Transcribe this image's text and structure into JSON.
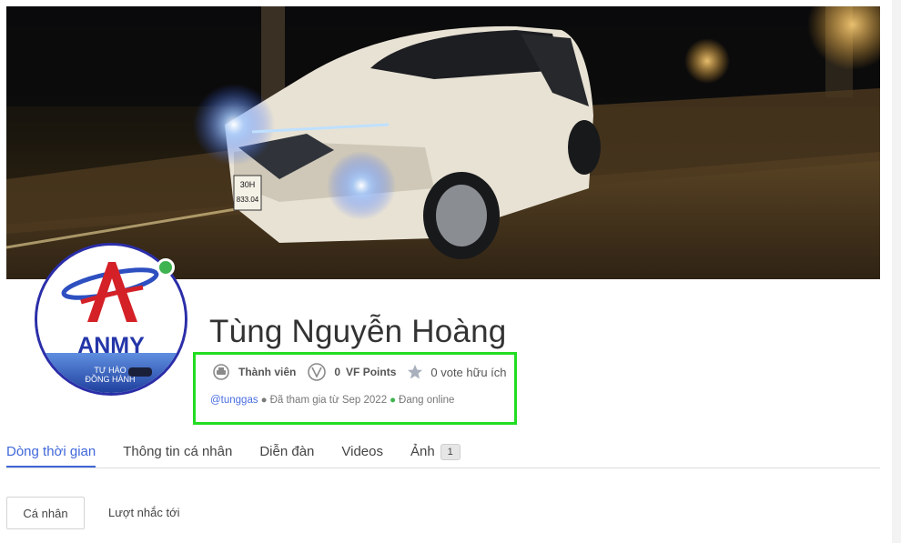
{
  "profile": {
    "name": "Tùng Nguyễn Hoàng",
    "avatar_text": "ANMY",
    "avatar_tagline_1": "TỰ HÀO",
    "avatar_tagline_2": "ĐỒNG HÀNH",
    "cover_plate_line1": "30H",
    "cover_plate_line2": "833.04",
    "online": true
  },
  "stats": {
    "rank_label": "Thành viên",
    "points_value": "0",
    "points_label": "VF Points",
    "votes_label": "0 vote hữu ích"
  },
  "meta": {
    "handle": "@tunggas",
    "joined": "Đã tham gia từ Sep 2022",
    "status": "Đang online"
  },
  "tabs": [
    {
      "label": "Dòng thời gian",
      "active": true
    },
    {
      "label": "Thông tin cá nhân",
      "active": false
    },
    {
      "label": "Diễn đàn",
      "active": false
    },
    {
      "label": "Videos",
      "active": false
    },
    {
      "label": "Ảnh",
      "active": false,
      "badge": "1"
    }
  ],
  "subtabs": [
    {
      "label": "Cá nhân",
      "active": true
    },
    {
      "label": "Lượt nhắc tới",
      "active": false
    }
  ],
  "colors": {
    "accent": "#3f67d9",
    "online": "#3fb34f",
    "highlight": "#22dd22"
  }
}
